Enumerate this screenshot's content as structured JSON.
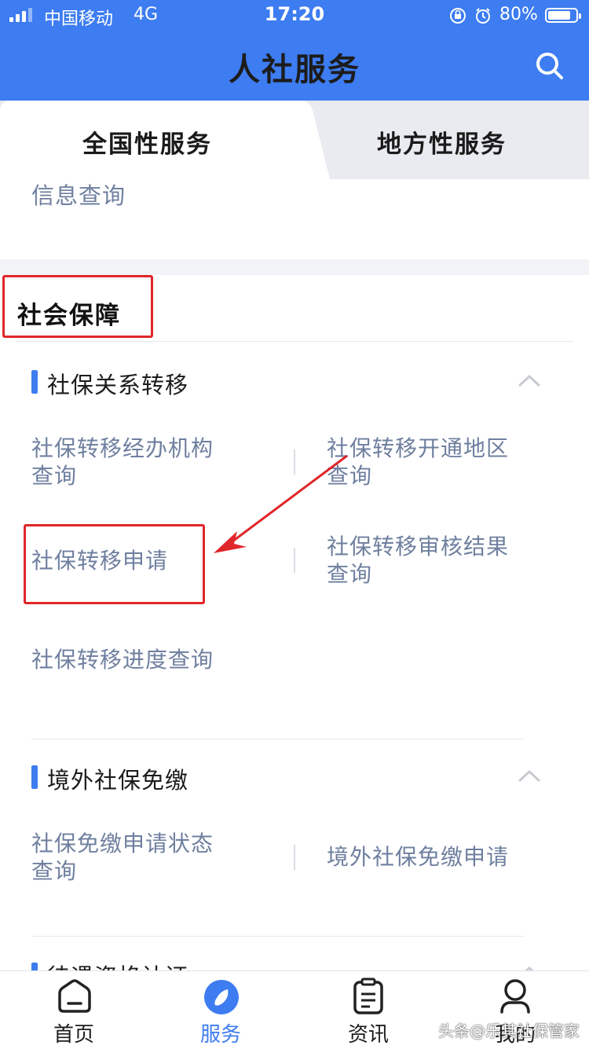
{
  "status_bar": {
    "carrier": "中国移动",
    "network": "4G",
    "time": "17:20",
    "battery": "80%"
  },
  "header": {
    "title": "人社服务"
  },
  "tabs": [
    {
      "label": "全国性服务",
      "active": true
    },
    {
      "label": "地方性服务",
      "active": false
    }
  ],
  "info_link": "信息查询",
  "section": {
    "title": "社会保障"
  },
  "groups": [
    {
      "title": "社保关系转移",
      "items": [
        {
          "line1": "社保转移经办机构",
          "line2": "查询"
        },
        {
          "line1": "社保转移开通地区",
          "line2": "查询"
        },
        {
          "line1": "社保转移申请",
          "line2": ""
        },
        {
          "line1": "社保转移审核结果",
          "line2": "查询"
        },
        {
          "line1": "社保转移进度查询",
          "line2": ""
        }
      ]
    },
    {
      "title": "境外社保免缴",
      "items": [
        {
          "line1": "社保免缴申请状态",
          "line2": "查询"
        },
        {
          "line1": "境外社保免缴申请",
          "line2": ""
        }
      ]
    },
    {
      "title": "待遇资格认证"
    }
  ],
  "bottom_nav": [
    {
      "label": "首页",
      "icon": "home-icon"
    },
    {
      "label": "服务",
      "icon": "service-compass-icon",
      "active": true
    },
    {
      "label": "资讯",
      "icon": "news-icon"
    },
    {
      "label": "我的",
      "icon": "profile-icon"
    }
  ],
  "watermark": "头条@乐其社保管家",
  "colors": {
    "primary": "#3d7cf1",
    "link": "#6f7f9f",
    "highlight": "#e0262b"
  }
}
